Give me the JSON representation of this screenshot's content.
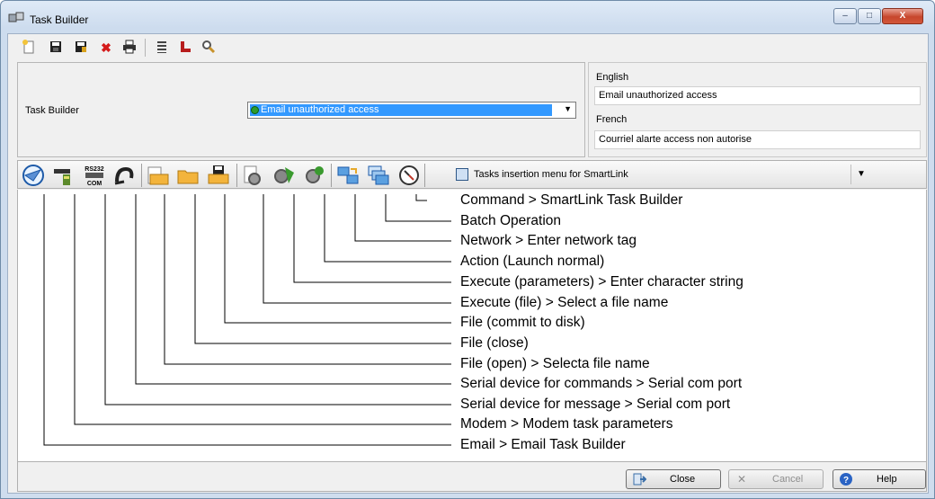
{
  "window": {
    "title": "Task Builder",
    "controls": [
      "–",
      "□",
      "X"
    ]
  },
  "toolbar": {
    "icons": [
      "new-icon",
      "save-icon",
      "save-as-icon",
      "delete-icon",
      "print-icon",
      "list-icon",
      "link-icon",
      "search-icon"
    ]
  },
  "form": {
    "task_builder_label": "Task Builder",
    "task_value": "Email unauthorized access",
    "english_label": "English",
    "english_value": "Email unauthorized access",
    "french_label": "French",
    "french_value": "Courriel alarte access non autorise"
  },
  "taskbar": {
    "icons": [
      "email-icon",
      "modem-icon",
      "rs232-icon",
      "serial-commands-icon",
      "file-open-icon",
      "file-close-icon",
      "file-commit-icon",
      "execute-file-icon",
      "execute-parameters-icon",
      "action-icon",
      "network-icon",
      "batch-icon",
      "command-icon"
    ],
    "rs232_text": "RS232",
    "com_text": "COM",
    "menu_label": "Tasks insertion menu for SmartLink"
  },
  "diagram": {
    "captions": [
      "Command > SmartLink Task Builder",
      "Batch Operation",
      "Network > Enter network tag",
      "Action (Launch normal)",
      "Execute (parameters) > Enter character string",
      "Execute (file) > Select a file name",
      "File (commit to disk)",
      "File (close)",
      "File (open) > Selecta file name",
      "Serial device for commands > Serial com port",
      "Serial device for message > Serial com port",
      "Modem > Modem task parameters",
      "Email > Email Task Builder"
    ]
  },
  "buttons": {
    "close": "Close",
    "cancel": "Cancel",
    "help": "Help"
  }
}
